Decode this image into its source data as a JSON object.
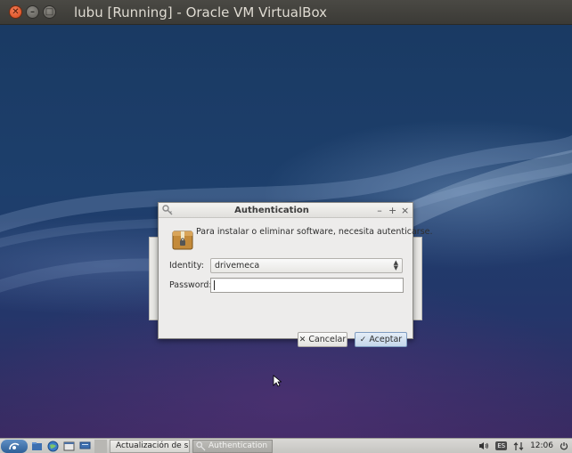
{
  "host_window": {
    "title": "lubu [Running] - Oracle VM VirtualBox",
    "close_glyph": "✕",
    "minimize_glyph": "–",
    "maximize_glyph": "□"
  },
  "auth_dialog": {
    "title": "Authentication",
    "controls": [
      "–",
      "+",
      "×"
    ],
    "message": "Para instalar o eliminar software, necesita autenticarse.",
    "identity_label": "Identity:",
    "identity_value": "drivemeca",
    "password_label": "Password:",
    "password_value": "",
    "cancel_label": "Cancelar",
    "accept_label": "Aceptar",
    "cancel_icon": "✕",
    "accept_icon": "✓"
  },
  "taskbar": {
    "tasks": [
      {
        "label": "Actualización de s...",
        "active": false
      },
      {
        "label": "Authentication",
        "active": true
      }
    ],
    "keyboard_layout": "ES",
    "clock": "12:06"
  },
  "colors": {
    "accept_button": "#c4d6ea",
    "desktop_top": "#1a3a63",
    "desktop_bottom": "#3a2a62"
  }
}
